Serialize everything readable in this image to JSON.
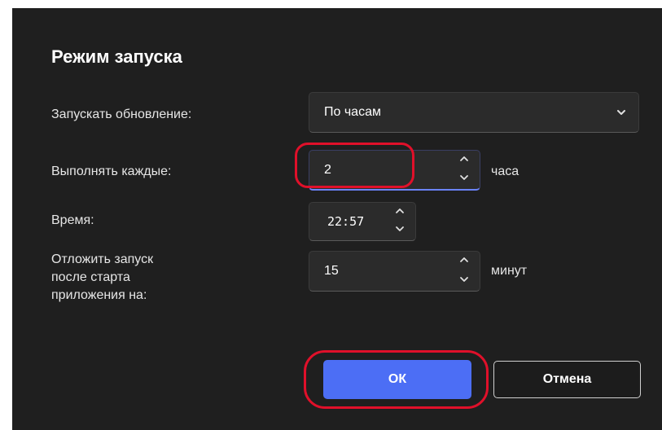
{
  "dialog": {
    "title": "Режим запуска"
  },
  "launch_update": {
    "label": "Запускать обновление:",
    "selected": "По часам"
  },
  "every": {
    "label": "Выполнять каждые:",
    "value": "2",
    "unit": "часа"
  },
  "time": {
    "label": "Время:",
    "value": "22:57"
  },
  "delay": {
    "label_line1": "Отложить запуск",
    "label_line2": "после старта",
    "label_line3": "приложения на:",
    "value": "15",
    "unit": "минут"
  },
  "buttons": {
    "ok": "ОК",
    "cancel": "Отмена"
  },
  "icons": {
    "dropdown": "chevron-down-icon",
    "spin_up": "chevron-up-icon",
    "spin_down": "chevron-down-icon"
  },
  "colors": {
    "background": "#1f1f1f",
    "accent": "#4c6ef5",
    "annotation": "#e0102a"
  }
}
